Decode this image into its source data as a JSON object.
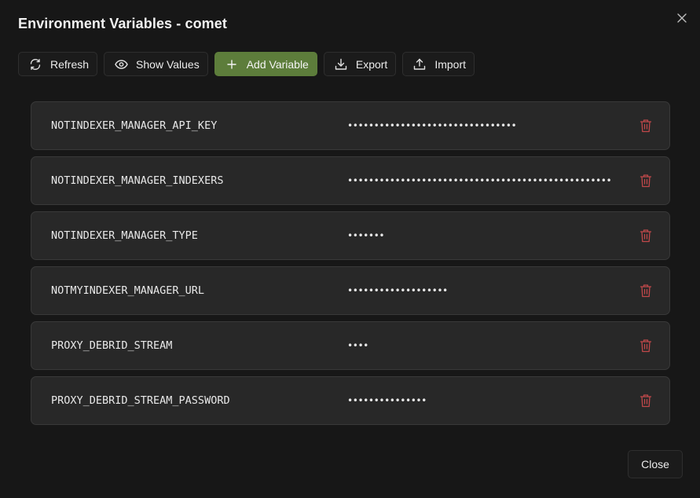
{
  "dialog": {
    "title": "Environment Variables - comet",
    "close_icon": "close-icon"
  },
  "toolbar": {
    "refresh_label": "Refresh",
    "show_values_label": "Show Values",
    "add_variable_label": "Add Variable",
    "export_label": "Export",
    "import_label": "Import"
  },
  "variables": [
    {
      "key": "NOTINDEXER_MANAGER_API_KEY",
      "value": "••••••••••••••••••••••••••••••••"
    },
    {
      "key": "NOTINDEXER_MANAGER_INDEXERS",
      "value": "••••••••••••••••••••••••••••••••••••••••••••••••••"
    },
    {
      "key": "NOTINDEXER_MANAGER_TYPE",
      "value": "•••••••"
    },
    {
      "key": "NOTMYINDEXER_MANAGER_URL",
      "value": "•••••••••••••••••••"
    },
    {
      "key": "PROXY_DEBRID_STREAM",
      "value": "••••"
    },
    {
      "key": "PROXY_DEBRID_STREAM_PASSWORD",
      "value": "•••••••••••••••"
    }
  ],
  "footer": {
    "close_label": "Close"
  },
  "colors": {
    "primary": "#5d7d3b",
    "danger": "#c0484a",
    "background": "#171717",
    "row": "#282828"
  }
}
